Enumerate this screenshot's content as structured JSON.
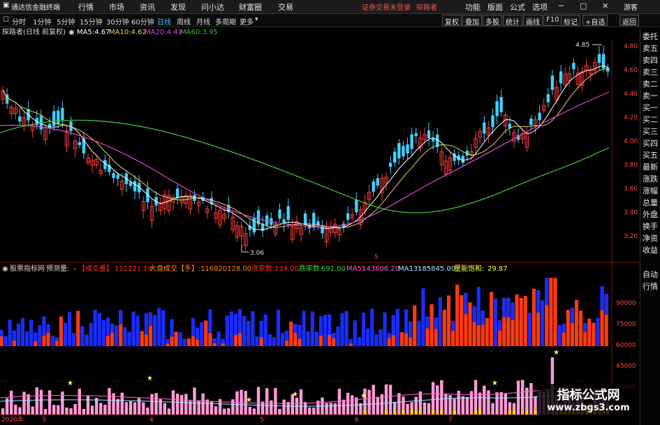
{
  "menu": {
    "app_title": "通达信金融终端",
    "items": [
      "行情",
      "市场",
      "资讯",
      "发现",
      "问小达",
      "财富圈",
      "交易"
    ],
    "notice": "证券交易未登录",
    "user_label": "探路者",
    "right_items": [
      "功能",
      "版面",
      "公式",
      "选项"
    ],
    "guest": "游客"
  },
  "toolbar": {
    "periods": [
      "分时",
      "1分钟",
      "5分钟",
      "15分钟",
      "30分钟",
      "60分钟",
      "日线",
      "周线",
      "月线",
      "多周期",
      "更多"
    ],
    "active_period": "日线",
    "right_buttons": [
      "复权",
      "叠加",
      "多股",
      "统计",
      "画线",
      "F10",
      "标记",
      "+自选",
      "返回"
    ]
  },
  "chart_header": {
    "stock_name": "探路者(日线 前复权)",
    "ma5_label": "MA5:",
    "ma5_value": "4.67",
    "ma10_label": "MA10:",
    "ma10_value": "4.62",
    "ma20_label": "MA20:",
    "ma20_value": "4.41",
    "ma60_label": "MA60:",
    "ma60_value": "3.95"
  },
  "price_axis": [
    "4.80",
    "4.60",
    "4.40",
    "4.20",
    "4.00",
    "3.80",
    "3.60",
    "3.40",
    "3.20"
  ],
  "price_markers": {
    "high": "4.85",
    "low": "3.06"
  },
  "indicator_header": {
    "name": "股票指标网",
    "forecast_label": "预测量:",
    "forecast_value": "-",
    "chengjiao_label": "【成交量】",
    "chengjiao_value": "111221.14",
    "dapan_label": "大盘成交【手】:",
    "dapan_value": "116820128.00",
    "zhangjia_label": "涨家数:",
    "zhangjia_value": "134.00",
    "diejia_label": "跌家数:",
    "diejia_value": "691.00",
    "ma5_label": "MA5:",
    "ma5_value": "143606.20",
    "ma13_label": "MA13:",
    "ma13_value": "185845.00",
    "liangneng_label": "量能饱和:",
    "liangneng_value": "29.87"
  },
  "volume_axis": [
    "90000",
    "75000",
    "60000",
    "45000",
    "30000"
  ],
  "date_axis": [
    "2020年",
    "3",
    "4",
    "5",
    "6",
    "7"
  ],
  "side_tabs": [
    "委托",
    "卖五",
    "卖四",
    "卖三",
    "卖二",
    "卖一",
    "买一",
    "买二",
    "买三",
    "买四",
    "买五",
    "最新",
    "涨跌",
    "涨幅",
    "总量",
    "外盘",
    "换手",
    "净资",
    "收益"
  ],
  "side_bottom": [
    "自动",
    "行情"
  ],
  "watermark": {
    "title": "指标公式网",
    "url": "www.zbgs3.com"
  },
  "colors": {
    "up": "#ff3b3b",
    "down": "#3fd1ff",
    "ma5": "#ffffff",
    "ma10": "#e6d35a",
    "ma20": "#e048d6",
    "ma60": "#3bbf3b",
    "vol_red": "#ff3a10",
    "vol_blue": "#1a2cff",
    "pink": "#ff9ad6"
  }
}
